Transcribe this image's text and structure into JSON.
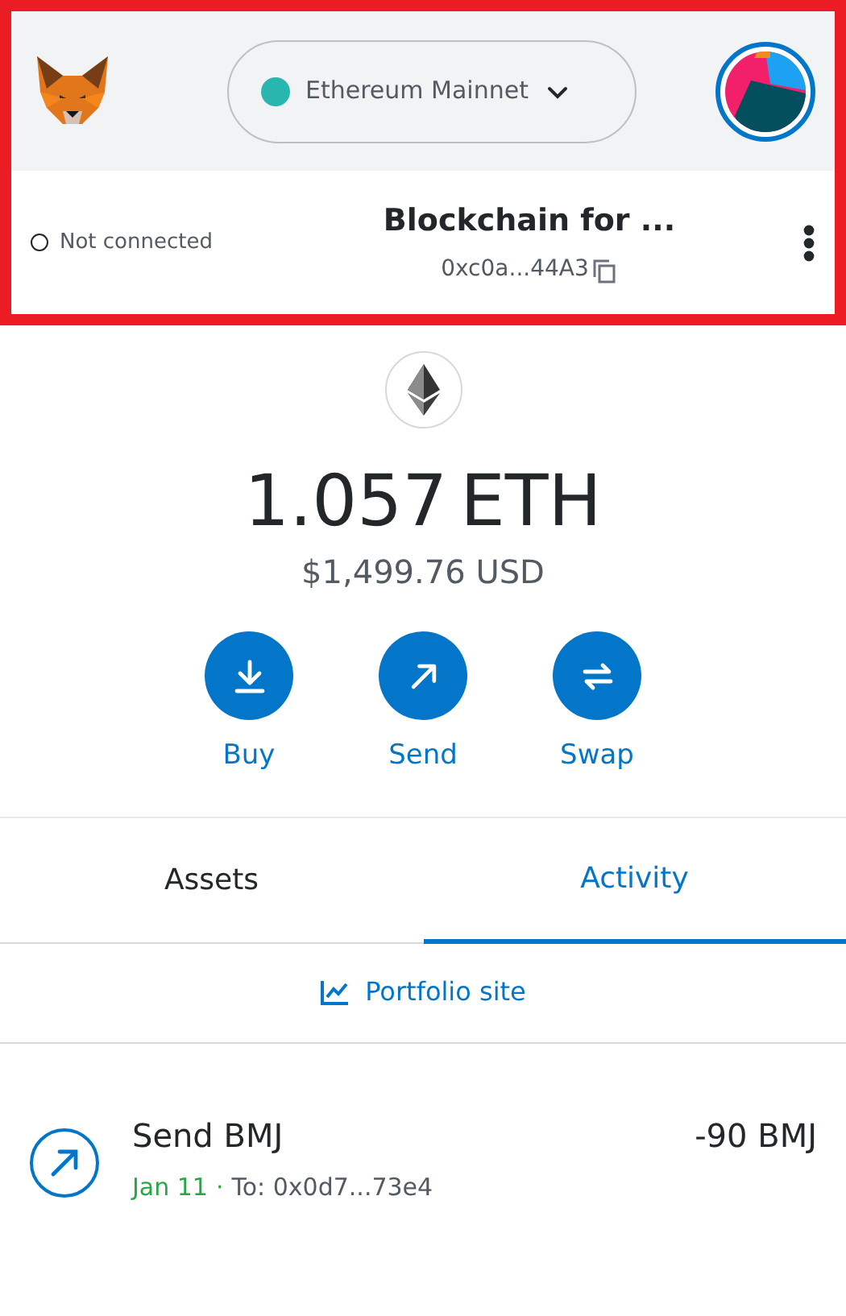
{
  "header": {
    "network": {
      "name": "Ethereum Mainnet",
      "color": "#29b6af"
    }
  },
  "account": {
    "connection": {
      "label": "Not connected",
      "connected": false
    },
    "name": "Blockchain for ...",
    "address": "0xc0a...44A3"
  },
  "balance": {
    "amount": "1.057",
    "unit": "ETH",
    "fiat": "$1,499.76 USD"
  },
  "actions": [
    {
      "kind": "buy",
      "label": "Buy"
    },
    {
      "kind": "send",
      "label": "Send"
    },
    {
      "kind": "swap",
      "label": "Swap"
    }
  ],
  "tabs": [
    {
      "label": "Assets",
      "selected": false
    },
    {
      "label": "Activity",
      "selected": true
    }
  ],
  "portfolio_link": "Portfolio site",
  "activity": [
    {
      "kind": "send",
      "title": "Send BMJ",
      "date": "Jan 11",
      "confirmed": true,
      "separator": "·",
      "recipient": "To: 0x0d7...73e4",
      "amount": "-90 BMJ"
    }
  ]
}
